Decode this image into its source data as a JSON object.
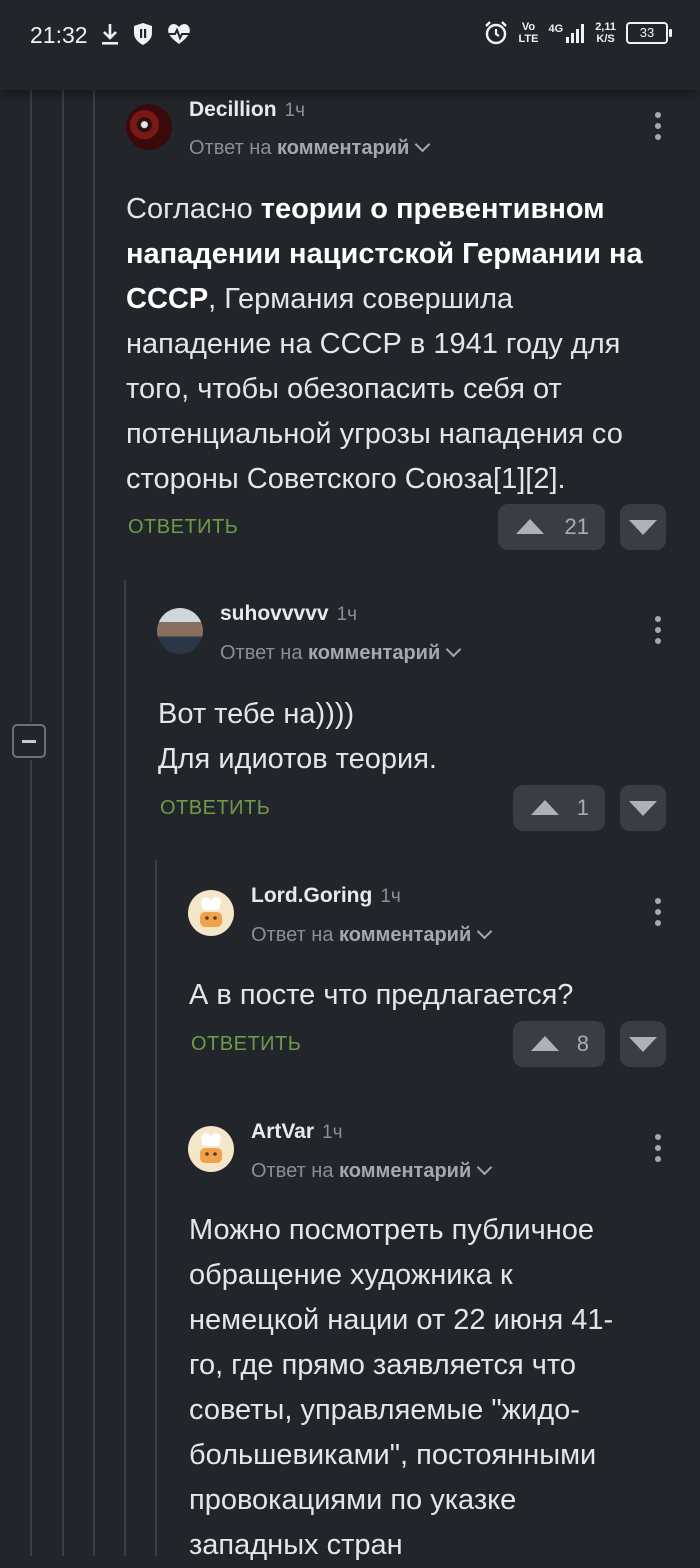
{
  "status_bar": {
    "time": "21:32",
    "left_icons": [
      "download-icon",
      "shield-icon",
      "heartbeat-icon"
    ],
    "network_1": "Vo",
    "network_2": "LTE",
    "signal_label": "4G",
    "speed_top": "2,11",
    "speed_bottom": "K/S",
    "battery": "33"
  },
  "comments": [
    {
      "author": "Decillion",
      "time": "1ч",
      "reply_prefix": "Ответ на",
      "reply_target": "комментарий",
      "body": [
        {
          "t": "Согласно ",
          "b": false
        },
        {
          "t": "теории о превентивном нападении нацистской Германии на СССР",
          "b": true
        },
        {
          "t": ", Германия совершила нападение на СССР в 1941 году для того, чтобы обезопасить себя от потенциальной угрозы нападения со стороны Советского Союза[1][2].",
          "b": false
        }
      ],
      "reply_label": "ОТВЕТИТЬ",
      "votes": "21"
    },
    {
      "author": "suhovvvvv",
      "time": "1ч",
      "reply_prefix": "Ответ на",
      "reply_target": "комментарий",
      "body_line1": "Вот тебе на))))",
      "body_line2": "Для идиотов теория.",
      "reply_label": "ОТВЕТИТЬ",
      "votes": "1"
    },
    {
      "author": "Lord.Goring",
      "time": "1ч",
      "reply_prefix": "Ответ на",
      "reply_target": "комментарий",
      "body": "А в посте что предлагается?",
      "reply_label": "ОТВЕТИТЬ",
      "votes": "8"
    },
    {
      "author": "ArtVar",
      "time": "1ч",
      "reply_prefix": "Ответ на",
      "reply_target": "комментарий",
      "body": "Можно посмотреть публичное обращение художника к немецкой нации от 22 июня 41-го, где прямо заявляется что советы, управляемые \"жидо-большевиками\", постоянными провокациями по указке западных стран"
    }
  ],
  "colors": {
    "background": "#22252a",
    "reply_link": "#6f9a4b",
    "vote_bg": "#3a3e44"
  }
}
